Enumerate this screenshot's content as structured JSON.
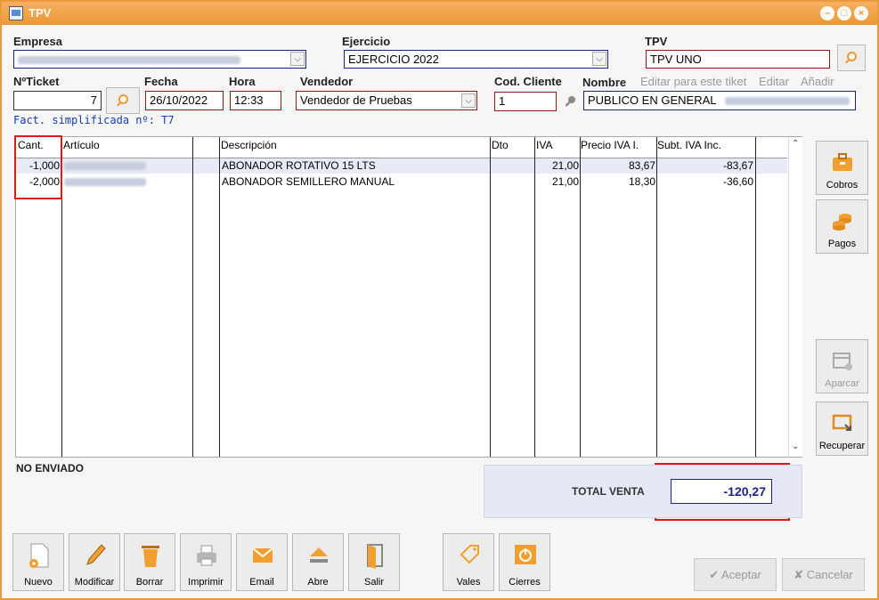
{
  "window": {
    "title": "TPV",
    "buttons": [
      "–",
      "□",
      "×"
    ]
  },
  "header": {
    "empresa_label": "Empresa",
    "ejercicio_label": "Ejercicio",
    "ejercicio_value": "EJERCICIO 2022",
    "tpv_label": "TPV",
    "tpv_value": "TPV UNO",
    "nticket_label": "NºTicket",
    "nticket_value": "7",
    "fecha_label": "Fecha",
    "fecha_value": "26/10/2022",
    "hora_label": "Hora",
    "hora_value": "12:33",
    "vendedor_label": "Vendedor",
    "vendedor_value": "Vendedor de Pruebas",
    "codcliente_label": "Cod. Cliente",
    "codcliente_value": "1",
    "nombre_label": "Nombre",
    "editar_ticket_link": "Editar para este tiket",
    "editar_link": "Editar",
    "anadir_link": "Añadir",
    "nombre_value": "PUBLICO EN GENERAL",
    "fact_simplificada": "Fact. simplificada nº: T7"
  },
  "grid": {
    "columns": [
      "Cant.",
      "Artículo",
      "Descripción",
      "Dto",
      "IVA",
      "Precio IVA I.",
      "Subt. IVA Inc."
    ],
    "rows": [
      {
        "cant": "-1,000",
        "descripcion": "ABONADOR ROTATIVO 15 LTS",
        "dto": "",
        "iva": "21,00",
        "precio": "83,67",
        "subtotal": "-83,67"
      },
      {
        "cant": "-2,000",
        "descripcion": "ABONADOR SEMILLERO MANUAL",
        "dto": "",
        "iva": "21,00",
        "precio": "18,30",
        "subtotal": "-36,60"
      }
    ]
  },
  "side_buttons": {
    "cobros": "Cobros",
    "pagos": "Pagos",
    "aparcar": "Aparcar",
    "recuperar": "Recuperar"
  },
  "status": "NO ENVIADO",
  "totals": {
    "label": "TOTAL VENTA",
    "value": "-120,27"
  },
  "toolbar": {
    "nuevo": "Nuevo",
    "modificar": "Modificar",
    "borrar": "Borrar",
    "imprimir": "Imprimir",
    "email": "Email",
    "abre": "Abre",
    "salir": "Salir",
    "vales": "Vales",
    "cierres": "Cierres"
  },
  "dialog": {
    "aceptar": "Aceptar",
    "cancelar": "Cancelar"
  },
  "colors": {
    "accent": "#ec9836",
    "highlight_box": "#e01818",
    "field_border": "#8b1a1a",
    "total_text": "#1a237e"
  }
}
